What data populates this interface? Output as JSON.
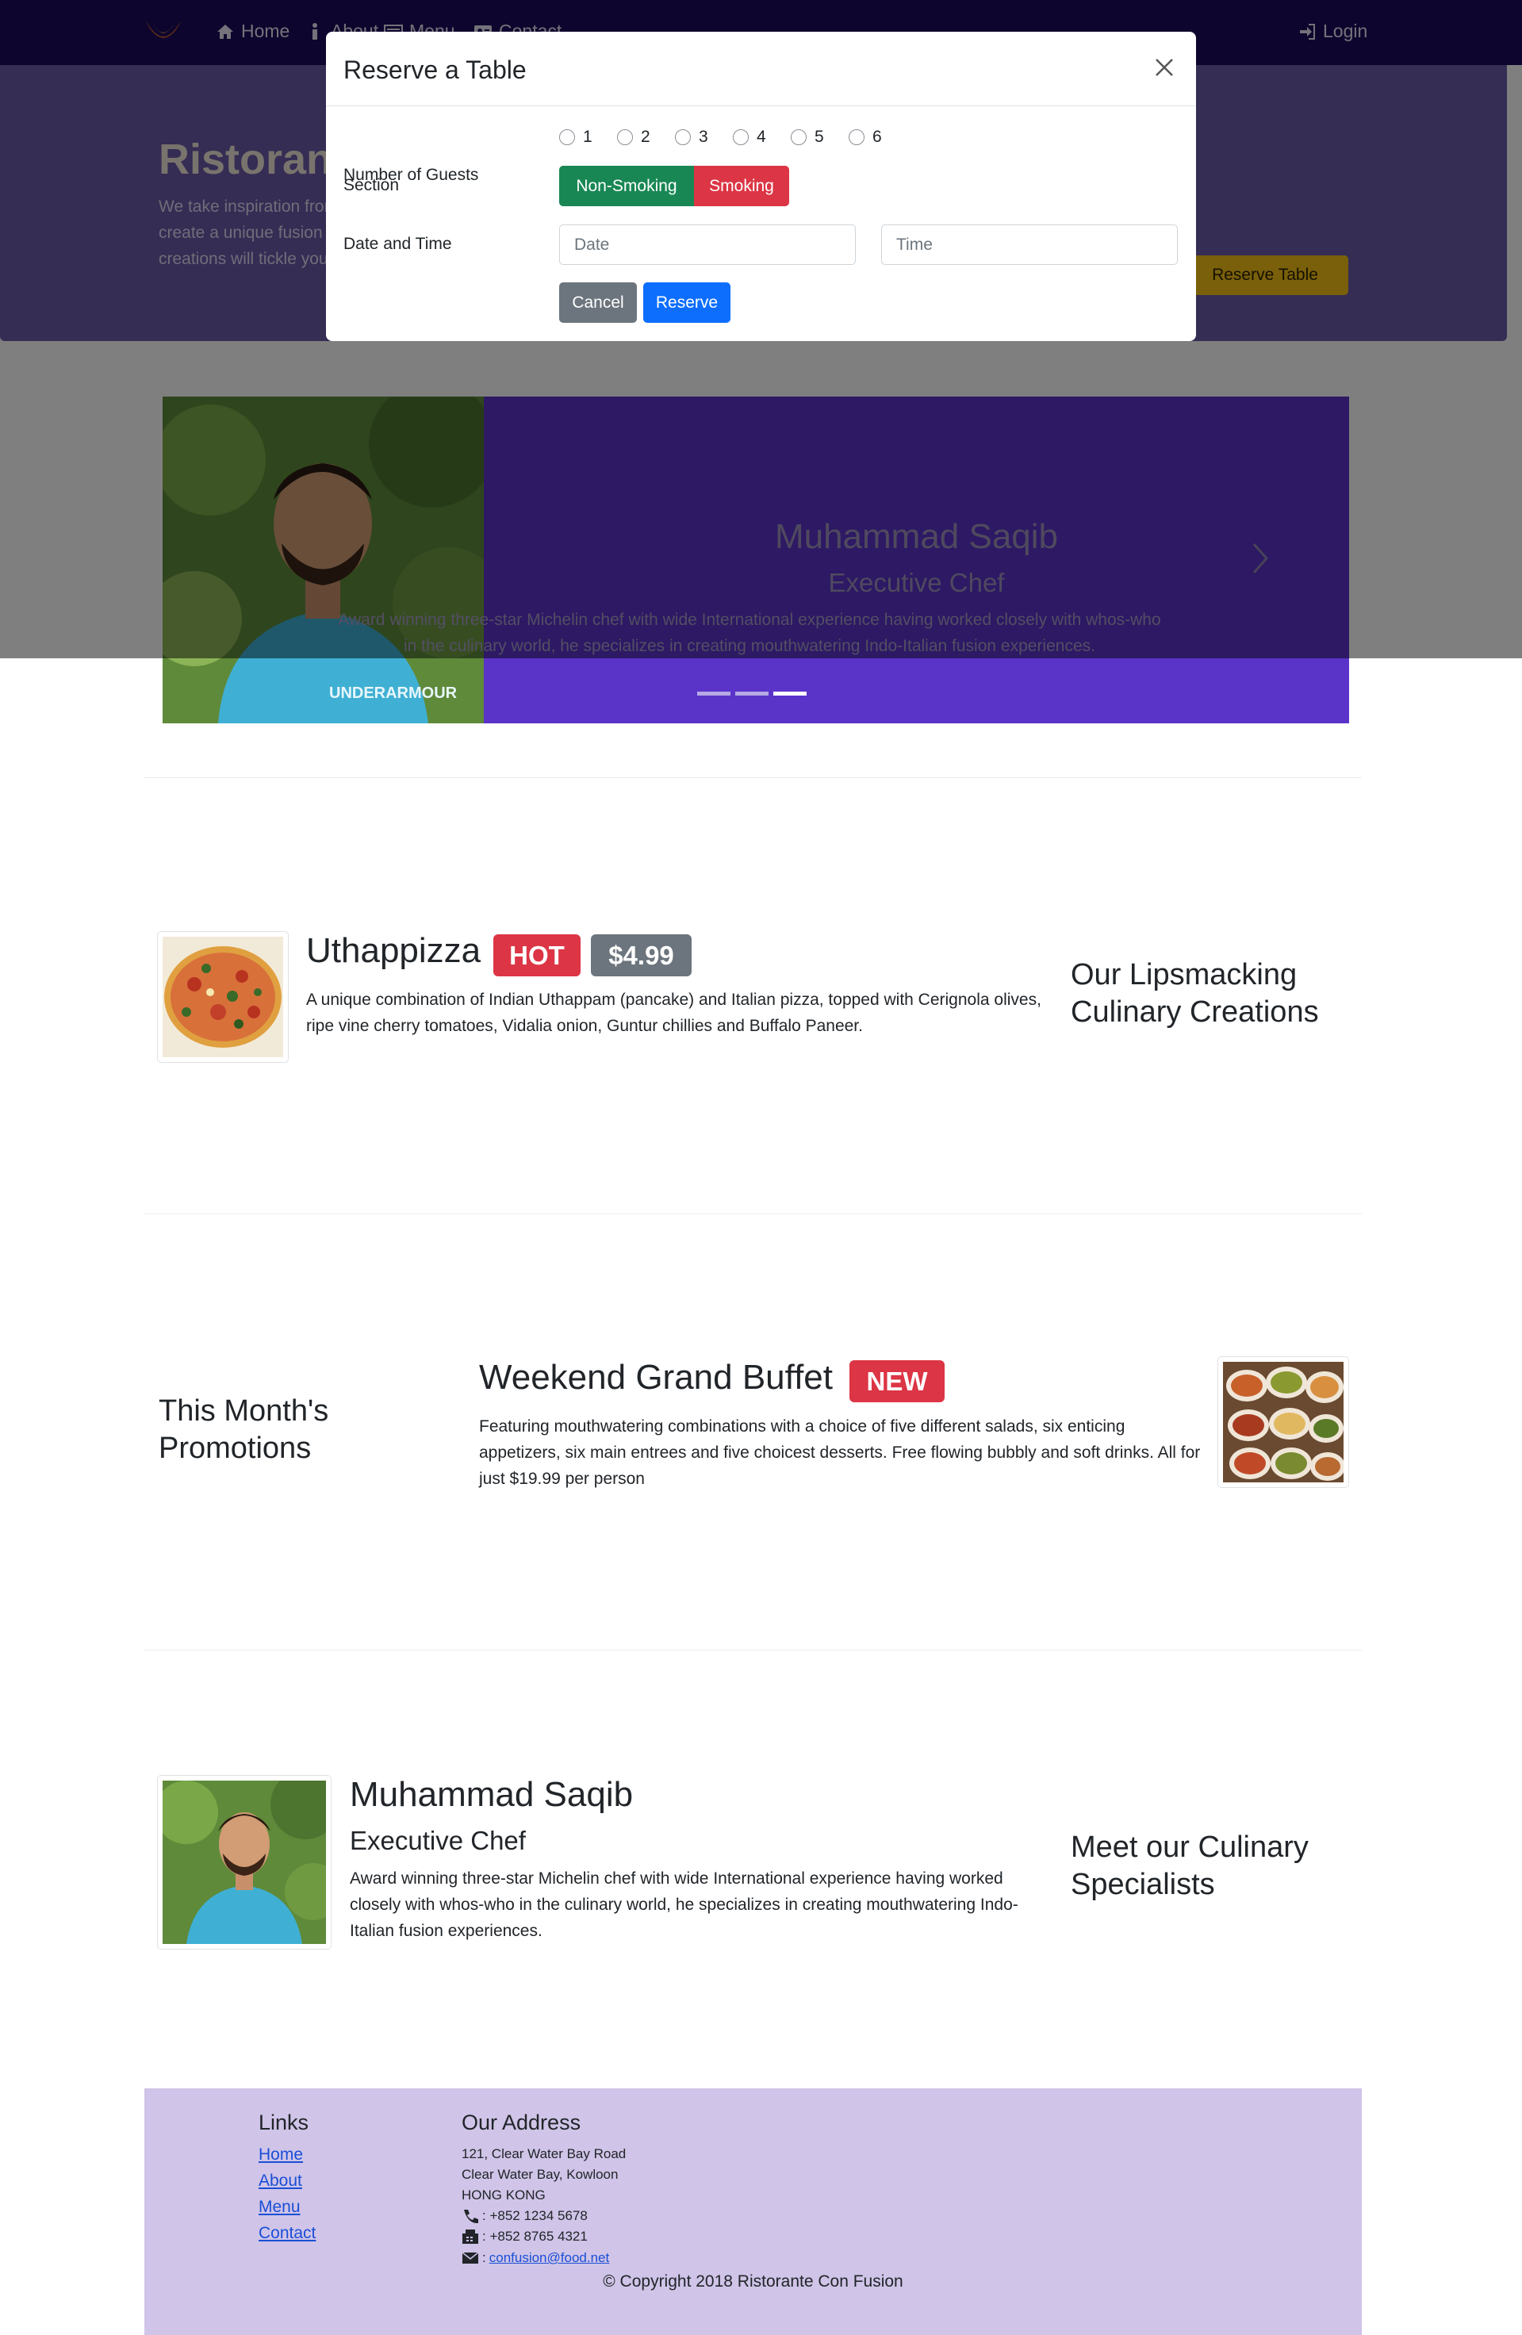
{
  "navbar": {
    "items": [
      {
        "label": "Home",
        "icon": "home-icon"
      },
      {
        "label": "About",
        "icon": "info-icon"
      },
      {
        "label": "Menu",
        "icon": "list-icon"
      },
      {
        "label": "Contact",
        "icon": "address-card-icon"
      }
    ],
    "login_label": "Login"
  },
  "jumbotron": {
    "title": "Ristorante Con Fusion",
    "text": "We take inspiration from the World's best cuisines, and create a unique fusion experience. Our lipsmacking creations will tickle your culinary senses!",
    "button_label": "Reserve Table"
  },
  "carousel": {
    "name": "Muhammad Saqib",
    "role": "Executive Chef",
    "text": "Award winning three-star Michelin chef with wide International experience having worked closely with whos-who in the culinary world, he specializes in creating mouthwatering Indo-Italian fusion experiences.",
    "active_index": 2,
    "indicator_count": 3
  },
  "modal": {
    "title": "Reserve a Table",
    "guests_label": "Number of Guests",
    "guest_options": [
      "1",
      "2",
      "3",
      "4",
      "5",
      "6"
    ],
    "section_label": "Section",
    "section_options": [
      "Non-Smoking",
      "Smoking"
    ],
    "datetime_label": "Date and Time",
    "date_placeholder": "Date",
    "time_placeholder": "Time",
    "cancel_label": "Cancel",
    "reserve_label": "Reserve"
  },
  "dish": {
    "title": "Uthappizza",
    "badge": "HOT",
    "price": "$4.99",
    "description": "A unique combination of Indian Uthappam (pancake) and Italian pizza, topped with Cerignola olives, ripe vine cherry tomatoes, Vidalia onion, Guntur chillies and Buffalo Paneer.",
    "side_heading": "Our Lipsmacking Culinary Creations"
  },
  "promotion": {
    "title": "Weekend Grand Buffet",
    "badge": "NEW",
    "description": "Featuring mouthwatering combinations with a choice of five different salads, six enticing appetizers, six main entrees and five choicest desserts. Free flowing bubbly and soft drinks. All for just $19.99 per person",
    "side_heading": "This Month's Promotions"
  },
  "leader": {
    "name": "Muhammad Saqib",
    "role": "Executive Chef",
    "description": "Award winning three-star Michelin chef with wide International experience having worked closely with whos-who in the culinary world, he specializes in creating mouthwatering Indo-Italian fusion experiences.",
    "side_heading": "Meet our Culinary Specialists"
  },
  "footer": {
    "links_heading": "Links",
    "links": [
      "Home",
      "About",
      "Menu",
      "Contact"
    ],
    "address_heading": "Our Address",
    "address_lines": [
      "121, Clear Water Bay Road",
      "Clear Water Bay, Kowloon",
      "HONG KONG"
    ],
    "phone": ": +852 1234 5678",
    "fax": ": +852 8765 4321",
    "email_prefix": ":",
    "email": "confusion@food.net",
    "copyright": "© Copyright 2018 Ristorante Con Fusion"
  },
  "colors": {
    "navbar": "#1d0a5c",
    "jumbotron": "#6a5aa8",
    "carousel": "#5a33c9",
    "footer": "#d0c4e8",
    "success": "#198754",
    "danger": "#dc3545",
    "secondary": "#6c757d",
    "primary": "#0d6efd",
    "warning": "#f5c117"
  }
}
